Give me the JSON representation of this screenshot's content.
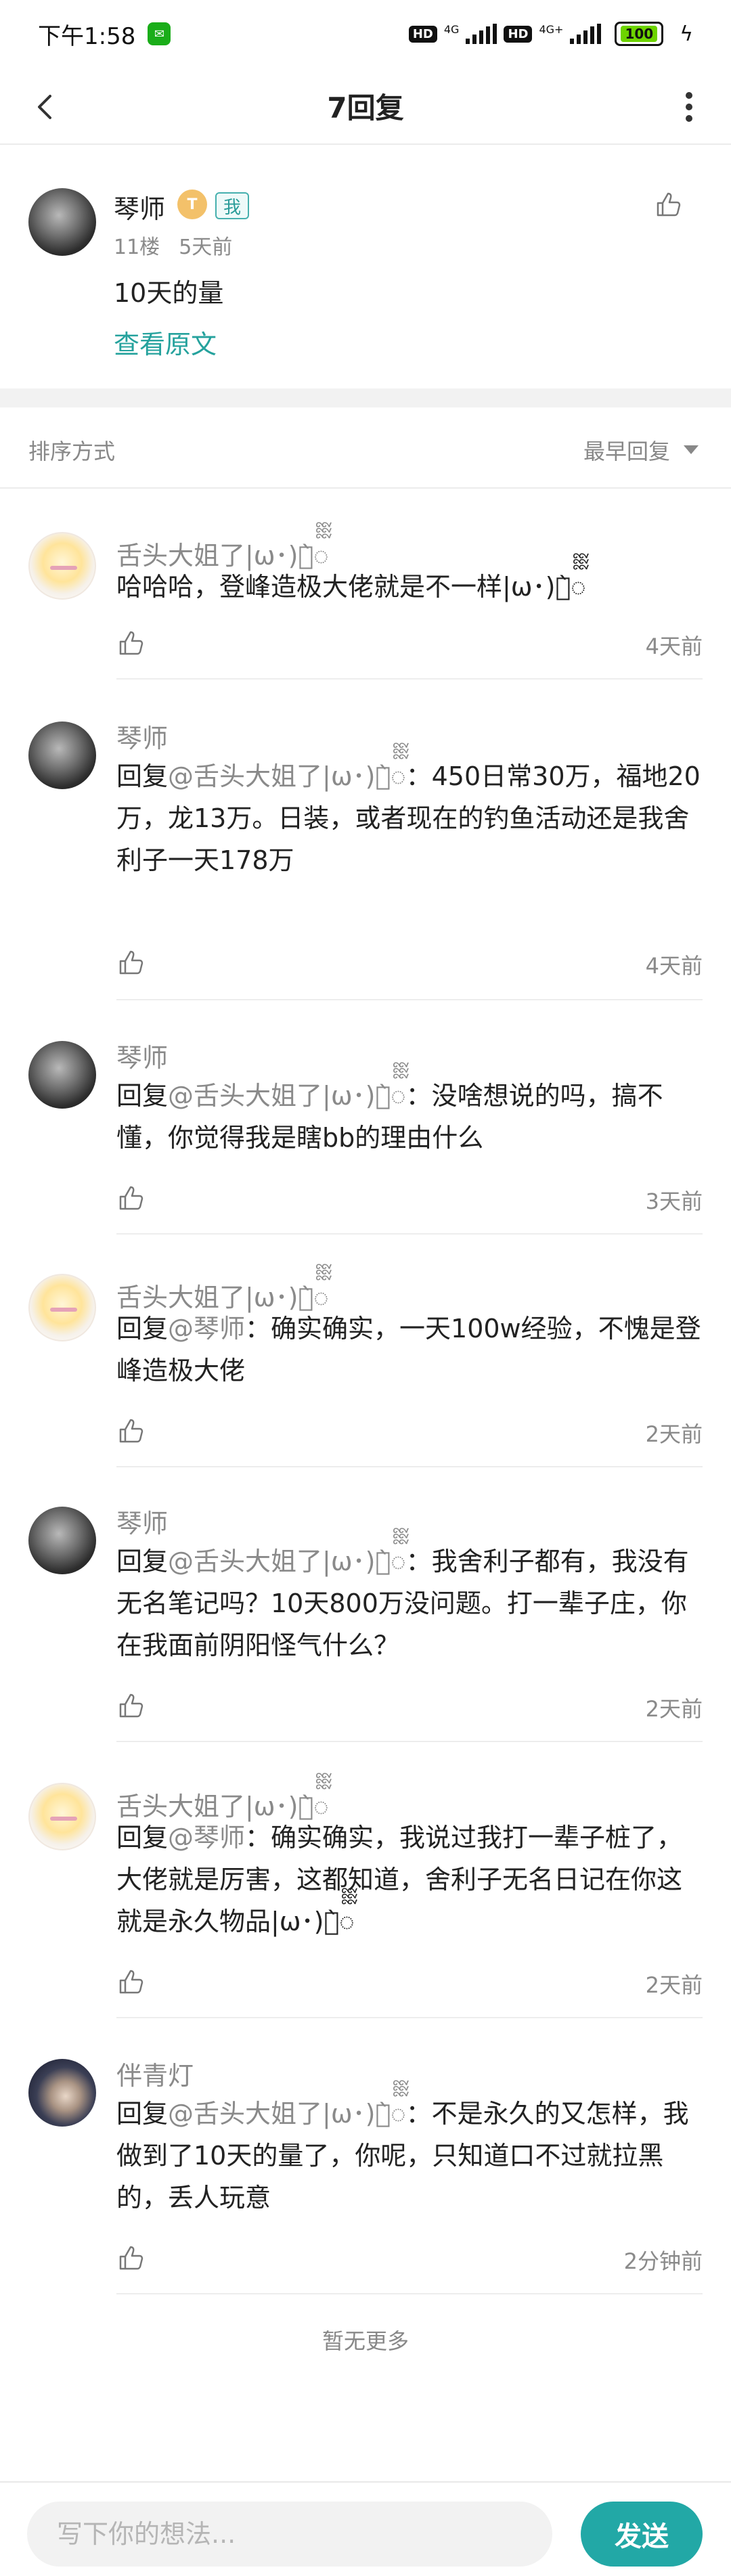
{
  "status_bar": {
    "time": "下午1:58",
    "hd1": "HD",
    "net1": "4G",
    "hd2": "HD",
    "net2": "4G+",
    "battery": "100"
  },
  "header": {
    "title": "7回复"
  },
  "main_post": {
    "author": "琴师",
    "level_badge": "T",
    "me_badge": "我",
    "floor": "11楼",
    "time": "5天前",
    "text": "10天的量",
    "view_original": "查看原文"
  },
  "sort": {
    "label": "排序方式",
    "value": "最早回复"
  },
  "replies": [
    {
      "author": "舌头大姐了|ω･)ง̀ᢆ",
      "prefix": "",
      "mention": "",
      "text": "哈哈哈，登峰造极大佬就是不一样|ω･)ง̀ᢆ",
      "time": "4天前"
    },
    {
      "author": "琴师",
      "prefix": "回复",
      "mention": "@舌头大姐了|ω･)ง̀ᢆ",
      "text": "：450日常30万，福地20万，龙13万。日装，或者现在的钓鱼活动还是我舍利子一天178万",
      "time": "4天前"
    },
    {
      "author": "琴师",
      "prefix": "回复",
      "mention": "@舌头大姐了|ω･)ง̀ᢆ",
      "text": "：没啥想说的吗，搞不懂，你觉得我是瞎bb的理由什么",
      "time": "3天前"
    },
    {
      "author": "舌头大姐了|ω･)ง̀ᢆ",
      "prefix": "回复",
      "mention": "@琴师",
      "text": "：确实确实，一天100w经验，不愧是登峰造极大佬",
      "time": "2天前"
    },
    {
      "author": "琴师",
      "prefix": "回复",
      "mention": "@舌头大姐了|ω･)ง̀ᢆ",
      "text": "：我舍利子都有，我没有无名笔记吗？10天800万没问题。打一辈子庄，你在我面前阴阳怪气什么？",
      "time": "2天前"
    },
    {
      "author": "舌头大姐了|ω･)ง̀ᢆ",
      "prefix": "回复",
      "mention": "@琴师",
      "text": "：确实确实，我说过我打一辈子桩了，大佬就是厉害，这都知道，舍利子无名日记在你这就是永久物品|ω･)ง̀ᢆ",
      "time": "2天前"
    },
    {
      "author": "伴青灯",
      "prefix": "回复",
      "mention": "@舌头大姐了|ω･)ง̀ᢆ",
      "text": "：不是永久的又怎样，我做到了10天的量了，你呢，只知道口不过就拉黑的，丢人玩意",
      "time": "2分钟前"
    }
  ],
  "no_more": "暂无更多",
  "composer": {
    "placeholder": "写下你的想法...",
    "send_label": "发送"
  },
  "colors": {
    "accent": "#22a8a6",
    "link": "#25a29d",
    "muted": "#8a8a8a"
  },
  "icons": {
    "back": "chevron-left-icon",
    "more": "more-vertical-icon",
    "like": "thumbs-up-icon",
    "sort": "caret-down-icon"
  }
}
